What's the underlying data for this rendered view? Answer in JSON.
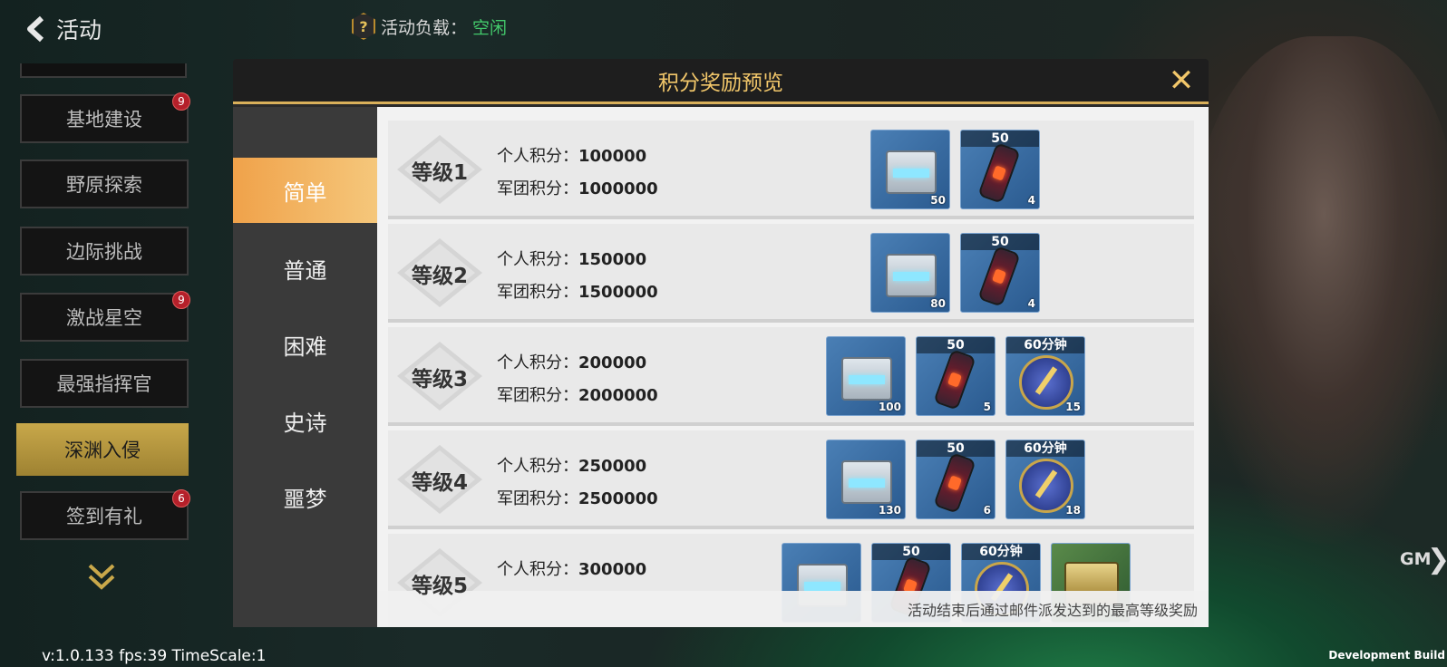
{
  "header": {
    "back_label": "活动",
    "load_label": "活动负载：",
    "load_value": "空闲"
  },
  "sidebar": {
    "items": [
      {
        "label": "基地建设",
        "badge": "9"
      },
      {
        "label": "野原探索",
        "badge": ""
      },
      {
        "label": "边际挑战",
        "badge": ""
      },
      {
        "label": "激战星空",
        "badge": "9"
      },
      {
        "label": "最强指挥官",
        "badge": ""
      },
      {
        "label": "深渊入侵",
        "badge": ""
      },
      {
        "label": "签到有礼",
        "badge": "6"
      }
    ]
  },
  "modal": {
    "title": "积分奖励预览",
    "close_label": "✕",
    "tabs": [
      "简单",
      "普通",
      "困难",
      "史诗",
      "噩梦"
    ],
    "personal_label": "个人积分：",
    "legion_label": "军团积分：",
    "levels": [
      {
        "name": "等级1",
        "personal": "100000",
        "legion": "1000000",
        "items": [
          {
            "kind": "chest",
            "tag": "",
            "qty": "50"
          },
          {
            "kind": "bottle",
            "tag": "50",
            "qty": "4"
          }
        ]
      },
      {
        "name": "等级2",
        "personal": "150000",
        "legion": "1500000",
        "items": [
          {
            "kind": "chest",
            "tag": "",
            "qty": "80"
          },
          {
            "kind": "bottle",
            "tag": "50",
            "qty": "4"
          }
        ]
      },
      {
        "name": "等级3",
        "personal": "200000",
        "legion": "2000000",
        "items": [
          {
            "kind": "chest",
            "tag": "",
            "qty": "100"
          },
          {
            "kind": "bottle",
            "tag": "50",
            "qty": "5"
          },
          {
            "kind": "clock",
            "tag": "60分钟",
            "qty": "15"
          }
        ]
      },
      {
        "name": "等级4",
        "personal": "250000",
        "legion": "2500000",
        "items": [
          {
            "kind": "chest",
            "tag": "",
            "qty": "130"
          },
          {
            "kind": "bottle",
            "tag": "50",
            "qty": "6"
          },
          {
            "kind": "clock",
            "tag": "60分钟",
            "qty": "18"
          }
        ]
      },
      {
        "name": "等级5",
        "personal": "300000",
        "legion": "",
        "items": [
          {
            "kind": "chest",
            "tag": "",
            "qty": ""
          },
          {
            "kind": "bottle",
            "tag": "50",
            "qty": ""
          },
          {
            "kind": "clock",
            "tag": "60分钟",
            "qty": ""
          },
          {
            "kind": "gold",
            "tag": "",
            "qty": ""
          }
        ]
      }
    ],
    "footer_note": "活动结束后通过邮件派发达到的最高等级奖励"
  },
  "misc": {
    "gm_label": "GM",
    "version": "v:1.0.133 fps:39 TimeScale:1",
    "dev_build": "Development Build"
  }
}
